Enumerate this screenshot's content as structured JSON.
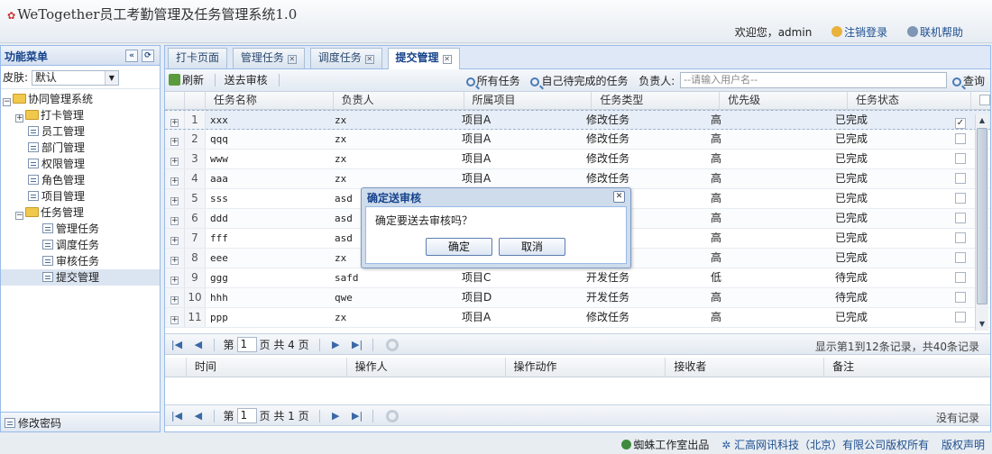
{
  "header": {
    "title": "WeTogether员工考勤管理及任务管理系统1.0",
    "welcome": "欢迎您，admin",
    "logout": "注销登录",
    "help": "联机帮助"
  },
  "sidebar": {
    "title": "功能菜单",
    "skin_label": "皮肤:",
    "skin_value": "默认",
    "tree": [
      {
        "label": "协同管理系统"
      },
      {
        "label": "打卡管理"
      },
      {
        "label": "员工管理"
      },
      {
        "label": "部门管理"
      },
      {
        "label": "权限管理"
      },
      {
        "label": "角色管理"
      },
      {
        "label": "项目管理"
      },
      {
        "label": "任务管理"
      },
      {
        "label": "管理任务"
      },
      {
        "label": "调度任务"
      },
      {
        "label": "审核任务"
      },
      {
        "label": "提交管理"
      }
    ],
    "footer": "修改密码"
  },
  "tabs": [
    {
      "label": "打卡页面"
    },
    {
      "label": "管理任务"
    },
    {
      "label": "调度任务"
    },
    {
      "label": "提交管理"
    }
  ],
  "toolbar": {
    "refresh": "刷新",
    "submit_review": "送去审核",
    "all_tasks": "所有任务",
    "my_pending": "自己待完成的任务",
    "owner_label": "负责人:",
    "owner_placeholder": "--请输入用户名--",
    "query": "查询"
  },
  "grid": {
    "columns": [
      "任务名称",
      "负责人",
      "所属项目",
      "任务类型",
      "优先级",
      "任务状态"
    ],
    "rows": [
      {
        "n": "1",
        "name": "xxx",
        "owner": "zx",
        "project": "项目A",
        "type": "修改任务",
        "priority": "高",
        "status": "已完成",
        "checked": "✓"
      },
      {
        "n": "2",
        "name": "qqq",
        "owner": "zx",
        "project": "项目A",
        "type": "修改任务",
        "priority": "高",
        "status": "已完成",
        "checked": ""
      },
      {
        "n": "3",
        "name": "www",
        "owner": "zx",
        "project": "项目A",
        "type": "修改任务",
        "priority": "高",
        "status": "已完成",
        "checked": ""
      },
      {
        "n": "4",
        "name": "aaa",
        "owner": "zx",
        "project": "项目A",
        "type": "修改任务",
        "priority": "高",
        "status": "已完成",
        "checked": ""
      },
      {
        "n": "5",
        "name": "sss",
        "owner": "asd",
        "project": "",
        "type": "",
        "priority": "高",
        "status": "已完成",
        "checked": ""
      },
      {
        "n": "6",
        "name": "ddd",
        "owner": "asd",
        "project": "",
        "type": "",
        "priority": "高",
        "status": "已完成",
        "checked": ""
      },
      {
        "n": "7",
        "name": "fff",
        "owner": "asd",
        "project": "",
        "type": "",
        "priority": "高",
        "status": "已完成",
        "checked": ""
      },
      {
        "n": "8",
        "name": "eee",
        "owner": "zx",
        "project": "",
        "type": "",
        "priority": "高",
        "status": "已完成",
        "checked": ""
      },
      {
        "n": "9",
        "name": "ggg",
        "owner": "safd",
        "project": "项目C",
        "type": "开发任务",
        "priority": "低",
        "status": "待完成",
        "checked": ""
      },
      {
        "n": "10",
        "name": "hhh",
        "owner": "qwe",
        "project": "项目D",
        "type": "开发任务",
        "priority": "高",
        "status": "待完成",
        "checked": ""
      },
      {
        "n": "11",
        "name": "ppp",
        "owner": "zx",
        "project": "项目A",
        "type": "修改任务",
        "priority": "高",
        "status": "已完成",
        "checked": ""
      }
    ]
  },
  "pager1": {
    "page_prefix": "第",
    "page": "1",
    "page_suffix": "页 共 4 页",
    "summary": "显示第1到12条记录，共40条记录"
  },
  "grid2": {
    "columns": [
      "时间",
      "操作人",
      "操作动作",
      "接收者",
      "备注"
    ]
  },
  "pager2": {
    "page_prefix": "第",
    "page": "1",
    "page_suffix": "页 共 1 页",
    "summary": "没有记录"
  },
  "footer": {
    "studio": "蜘蛛工作室出品",
    "company": "汇高网讯科技（北京）有限公司版权所有",
    "copyright": "版权声明"
  },
  "dialog": {
    "title": "确定送审核",
    "message": "确定要送去审核吗？",
    "ok": "确定",
    "cancel": "取消"
  }
}
